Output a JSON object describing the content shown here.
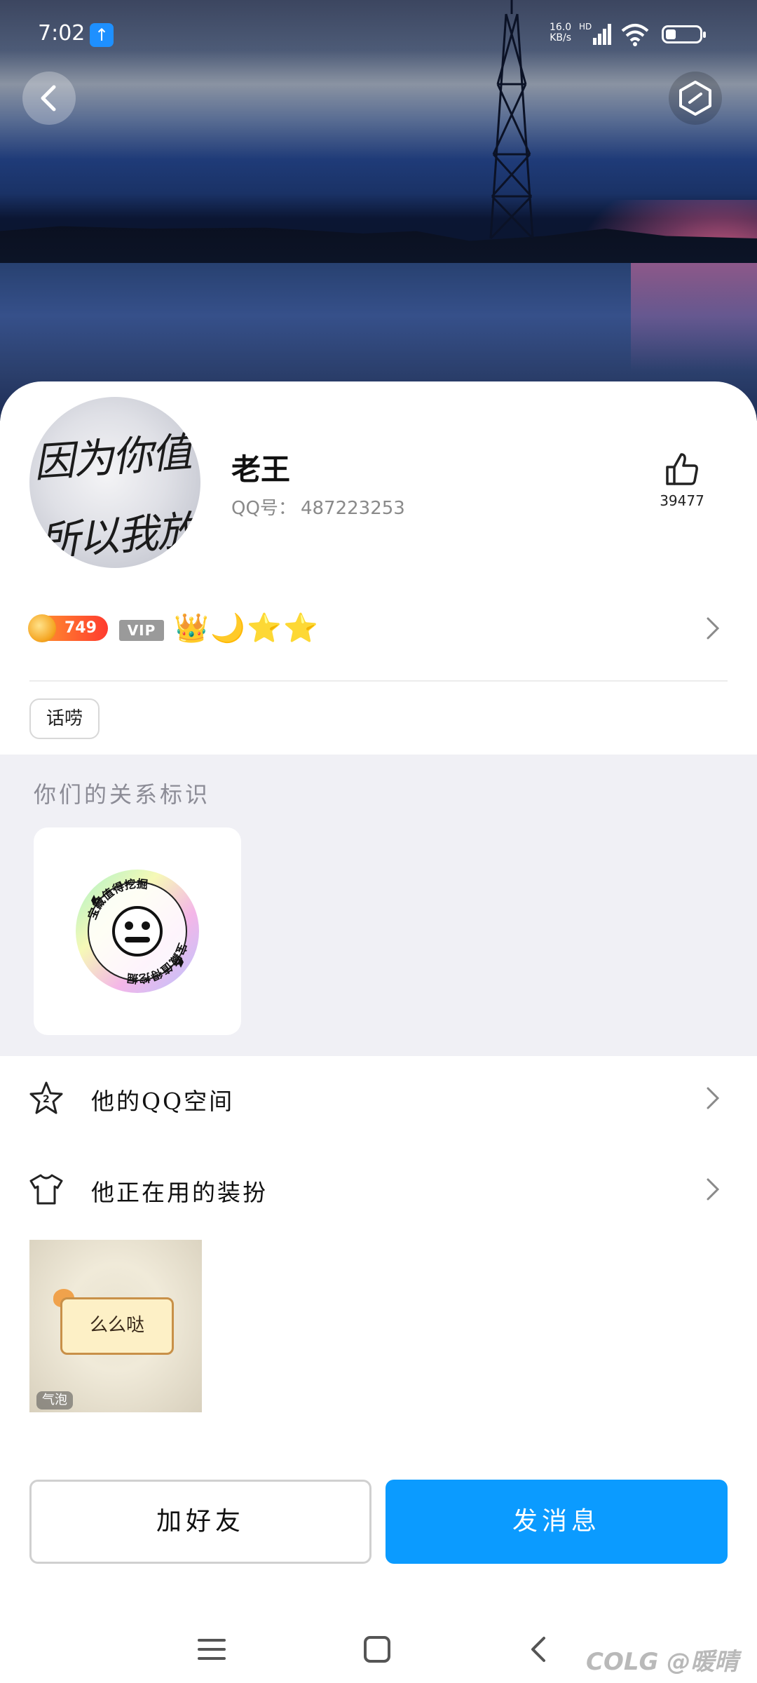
{
  "status_bar": {
    "time": "7:02",
    "net_speed_value": "16.0",
    "net_speed_unit": "KB/s",
    "hd_label": "HD",
    "icons": [
      "upload-icon",
      "signal-icon",
      "wifi-icon",
      "battery-icon"
    ]
  },
  "header": {
    "back_icon": "chevron-left-icon",
    "more_icon": "hexagon-more-icon"
  },
  "profile": {
    "avatar_text": "因为你值 所以我放",
    "nickname": "老王",
    "qq_label": "QQ号：",
    "qq_number": "487223253",
    "like_icon": "thumbs-up-icon",
    "like_count": "39477"
  },
  "badges": {
    "coin_value": "749",
    "vip_label": "VIP",
    "level_icons": [
      "crown-icon",
      "moon-icon",
      "star-icon",
      "star-icon"
    ]
  },
  "tags": [
    "话唠"
  ],
  "relation": {
    "title": "你们的关系标识",
    "badge_text": "宝藏值得挖掘"
  },
  "rows": [
    {
      "icon": "qzone-star-icon",
      "label": "他的QQ空间"
    },
    {
      "icon": "tshirt-icon",
      "label": "他正在用的装扮"
    }
  ],
  "costume": {
    "bubble_text": "么么哒",
    "chip_label": "气泡"
  },
  "actions": {
    "add_friend": "加好友",
    "send_message": "发消息"
  },
  "nav": {
    "icons": [
      "menu-icon",
      "home-square-icon",
      "back-triangle-icon"
    ],
    "watermark": "COLG @暖晴"
  }
}
